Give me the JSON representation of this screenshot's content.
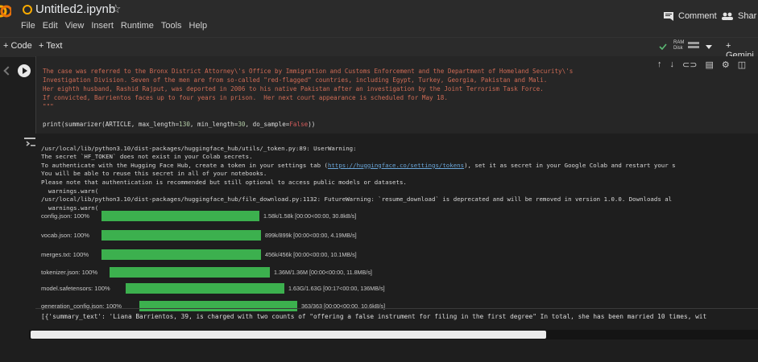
{
  "header": {
    "title": "Untitled2.ipynb",
    "star": "☆",
    "menu": [
      "File",
      "Edit",
      "View",
      "Insert",
      "Runtime",
      "Tools",
      "Help"
    ],
    "comment_label": "Comment",
    "share_label": "Shar"
  },
  "toolbar": {
    "code_label": "+ Code",
    "text_label": "+ Text",
    "ram_label": "RAM",
    "disk_label": "Disk",
    "gemini_label": "+ Gemini"
  },
  "cell": {
    "lines": [
      "The case was referred to the Bronx District Attorney\\'s Office by Immigration and Customs Enforcement and the Department of Homeland Security\\'s",
      "Investigation Division. Seven of the men are from so-called \"red-flagged\" countries, including Egypt, Turkey, Georgia, Pakistan and Mali.",
      "Her eighth husband, Rashid Rajput, was deported in 2006 to his native Pakistan after an investigation by the Joint Terrorism Task Force.",
      "If convicted, Barrientos faces up to four years in prison.  Her next court appearance is scheduled for May 18.",
      "\"\"\""
    ],
    "print_fn": "print(summarizer(ARTICLE, max_length=",
    "max_length": "130",
    "min_length_kw": ", min_length=",
    "min_length": "30",
    "do_sample_kw": ", do_sample=",
    "do_sample": "False",
    "close": "))"
  },
  "output": {
    "warning_1": "/usr/local/lib/python3.10/dist-packages/huggingface_hub/utils/_token.py:89: UserWarning:",
    "warning_2": "The secret `HF_TOKEN` does not exist in your Colab secrets.",
    "warning_3a": "To authenticate with the Hugging Face Hub, create a token in your settings tab (",
    "warning_link": "https://huggingface.co/settings/tokens",
    "warning_3b": "), set it as secret in your Google Colab and restart your s",
    "warning_4": "You will be able to reuse this secret in all of your notebooks.",
    "warning_5": "Please note that authentication is recommended but still optional to access public models or datasets.",
    "warning_6": "  warnings.warn(",
    "warning_7": "/usr/local/lib/python3.10/dist-packages/huggingface_hub/file_download.py:1132: FutureWarning: `resume_download` is deprecated and will be removed in version 1.0.0. Downloads al",
    "warning_8": "  warnings.warn(",
    "downloads": [
      {
        "name": "config.json:  100%",
        "progress": 1.0,
        "info": "1.58k/1.58k [00:00<00:00, 30.8kB/s]"
      },
      {
        "name": "vocab.json:  100%",
        "progress": 1.0,
        "info": "899k/899k [00:00<00:00, 4.19MB/s]"
      },
      {
        "name": "merges.txt:  100%",
        "progress": 1.0,
        "info": "456k/456k [00:00<00:00, 10.1MB/s]"
      },
      {
        "name": "tokenizer.json:  100%",
        "progress": 1.0,
        "info": "1.36M/1.36M [00:00<00:00, 11.8MB/s]"
      },
      {
        "name": "model.safetensors:  100%",
        "progress": 1.0,
        "info": "1.63G/1.63G [00:17<00:00, 136MB/s]"
      },
      {
        "name": "generation_config.json:  100%",
        "progress": 1.0,
        "info": "363/363 [00:00<00:00, 10.6kB/s]"
      }
    ],
    "summary": "[{'summary_text': 'Liana Barrientos, 39, is charged with two counts of \"offering a false instrument for filing in the first degree\" In total, she has been married 10 times, wit"
  },
  "colors": {
    "background": "#1e1e1e",
    "header": "#2b2b2b",
    "progress": "#3cb04e",
    "string": "#ce6b55",
    "link": "#6aa6d9"
  }
}
